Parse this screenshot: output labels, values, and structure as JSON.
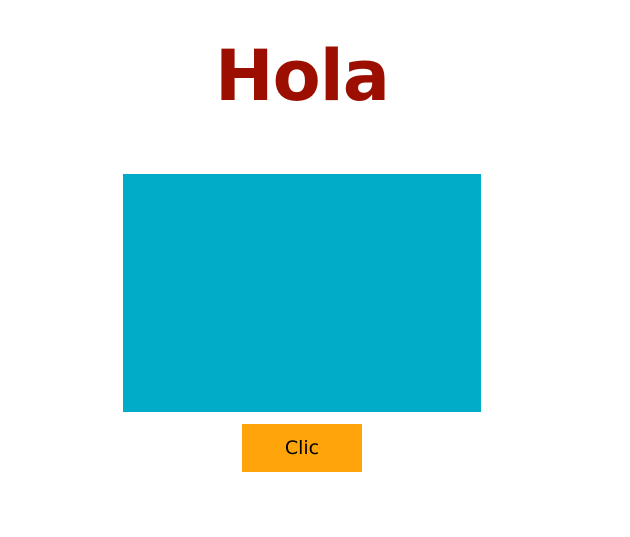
{
  "heading": {
    "text": "Hola",
    "color": "#9b0e00"
  },
  "box": {
    "color": "#00acc7"
  },
  "button": {
    "label": "Clic",
    "color": "#ffa40a"
  }
}
